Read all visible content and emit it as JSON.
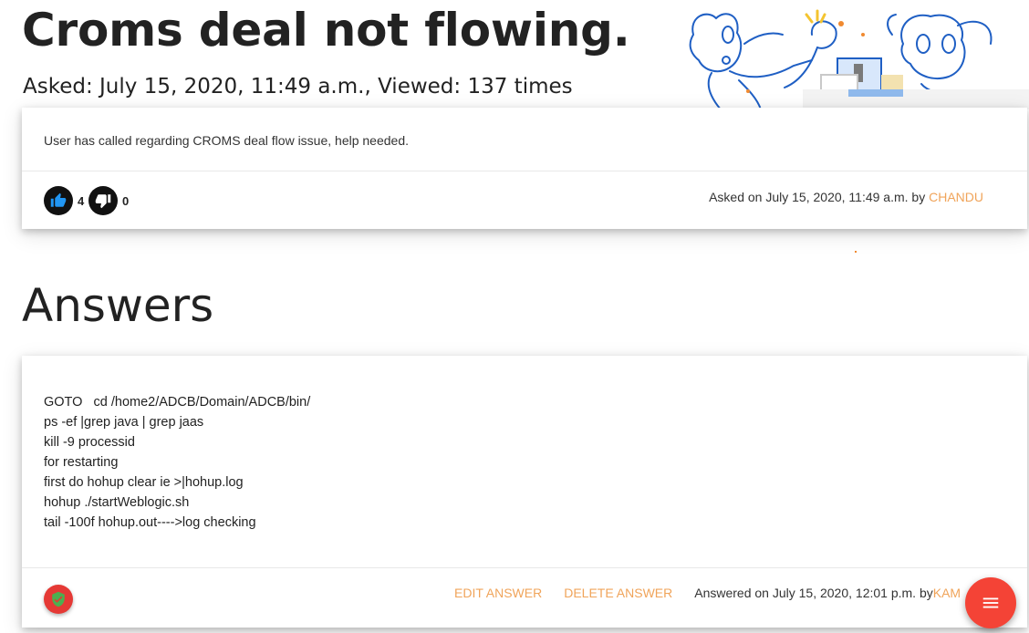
{
  "question": {
    "title": "Croms deal not flowing.",
    "meta": "Asked: July 15, 2020, 11:49 a.m., Viewed: 137 times",
    "body": "User has called regarding CROMS deal flow issue, help needed.",
    "upvotes": "4",
    "downvotes": "0",
    "asked_on_prefix": "Asked on July 15, 2020, 11:49 a.m. by ",
    "author": "CHANDU"
  },
  "answers_heading": "Answers",
  "answer": {
    "lines": [
      "GOTO   cd /home2/ADCB/Domain/ADCB/bin/",
      "ps -ef |grep java | grep jaas",
      "kill -9 processid",
      "for restarting",
      "first do hohup clear ie >|hohup.log",
      "hohup ./startWeblogic.sh",
      "tail -100f hohup.out---->log checking"
    ],
    "edit_label": "EDIT ANSWER",
    "delete_label": "DELETE ANSWER",
    "answered_on_prefix": "Answered on July 15, 2020, 12:01 p.m. by ",
    "author": "KAM"
  },
  "icons": {
    "upvote": "thumbs-up-icon",
    "downvote": "thumbs-down-icon",
    "accept": "shield-check-icon",
    "menu": "hamburger-menu-icon"
  },
  "colors": {
    "accent": "#f0a45a",
    "fab": "#f44336",
    "accept": "#e53935",
    "vote_bg": "#111111",
    "upvote_icon": "#2196f3"
  }
}
